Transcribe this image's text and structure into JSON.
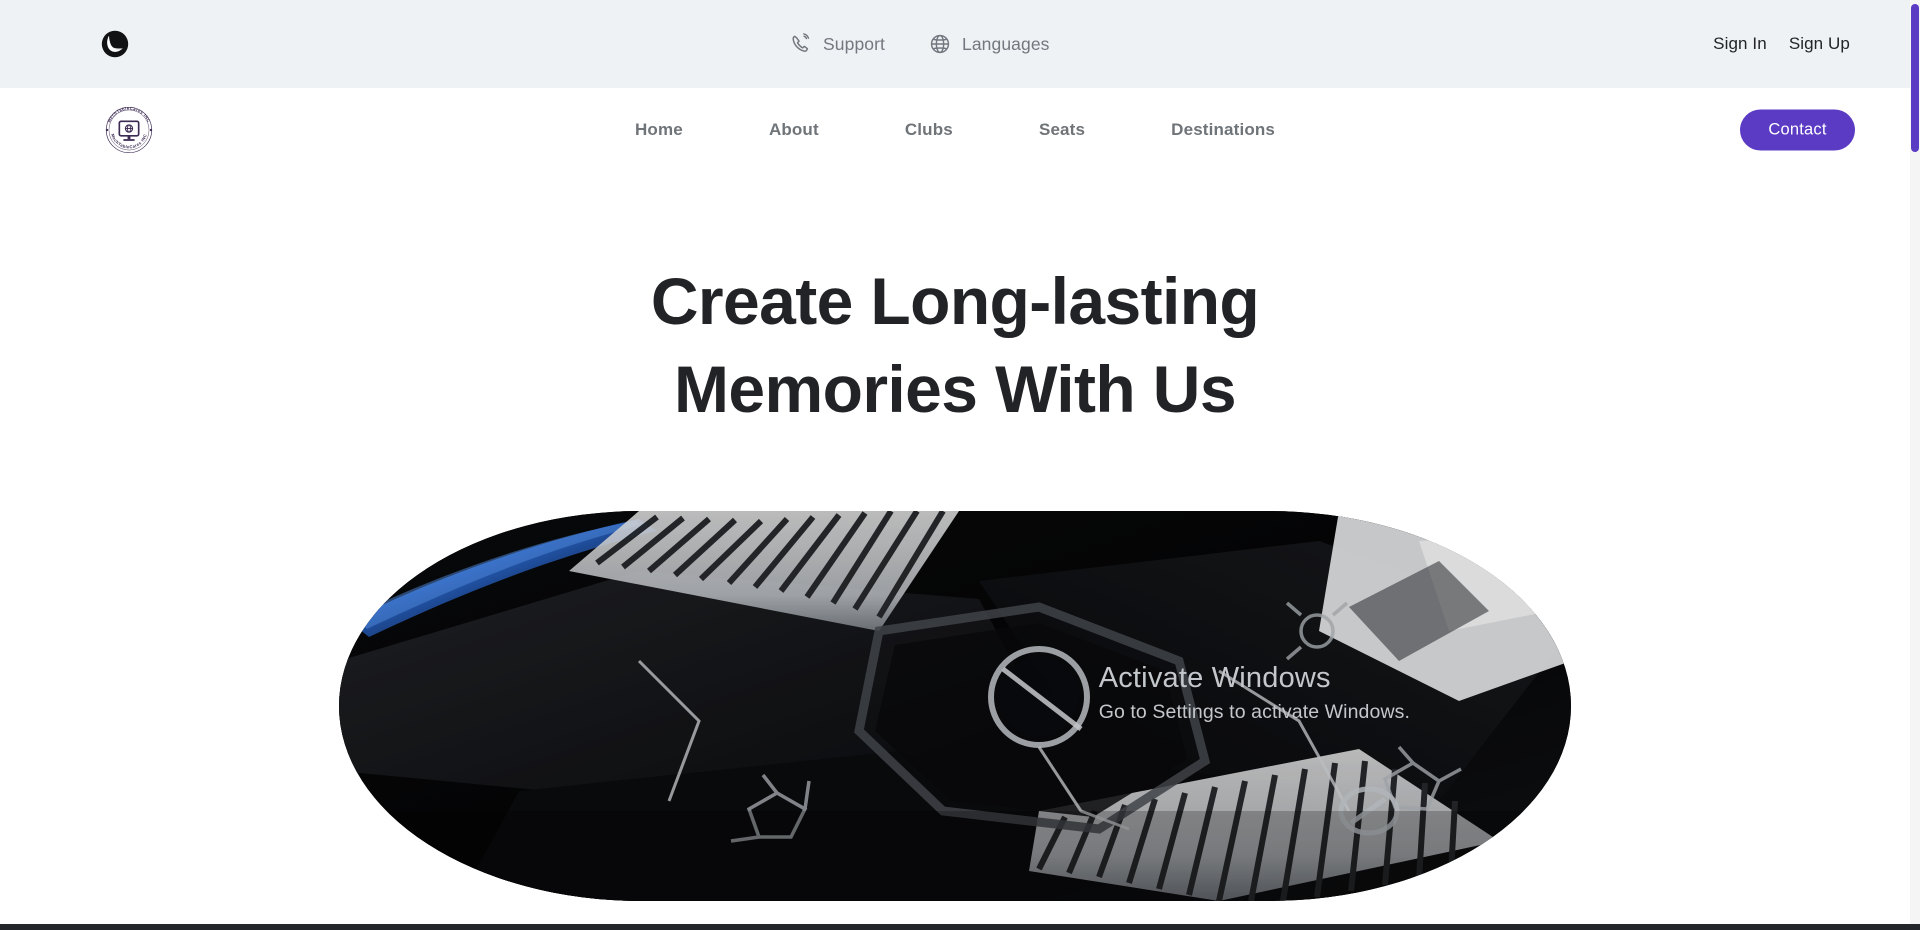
{
  "topbar": {
    "brand_icon": "turkish-airlines-bird-icon",
    "links": [
      {
        "label": "Support",
        "icon": "phone-ringing-icon"
      },
      {
        "label": "Languages",
        "icon": "globe-icon"
      }
    ],
    "auth": [
      {
        "label": "Sign In"
      },
      {
        "label": "Sign Up"
      }
    ]
  },
  "nav": {
    "logo": {
      "name": "mechtablecares-badge-logo",
      "text_top": "MechTableCares INC",
      "text_bottom": "MechTableCares INC",
      "inner_icon": "monitor-globe-icon"
    },
    "items": [
      {
        "label": "Home"
      },
      {
        "label": "About"
      },
      {
        "label": "Clubs"
      },
      {
        "label": "Seats"
      },
      {
        "label": "Destinations"
      }
    ],
    "contact_label": "Contact"
  },
  "hero": {
    "title_line_1": "Create Long-lasting",
    "title_line_2": "Memories With Us",
    "media_alt": "dark-scifi-mechanical-render"
  },
  "watermark": {
    "title": "Activate Windows",
    "subtitle": "Go to Settings to activate Windows."
  },
  "colors": {
    "accent_purple": "#5b3bc4",
    "topbar_bg": "#eff2f4",
    "muted_text": "#72787f",
    "heading_text": "#222326",
    "watermark_text": "#c3c7cb"
  }
}
